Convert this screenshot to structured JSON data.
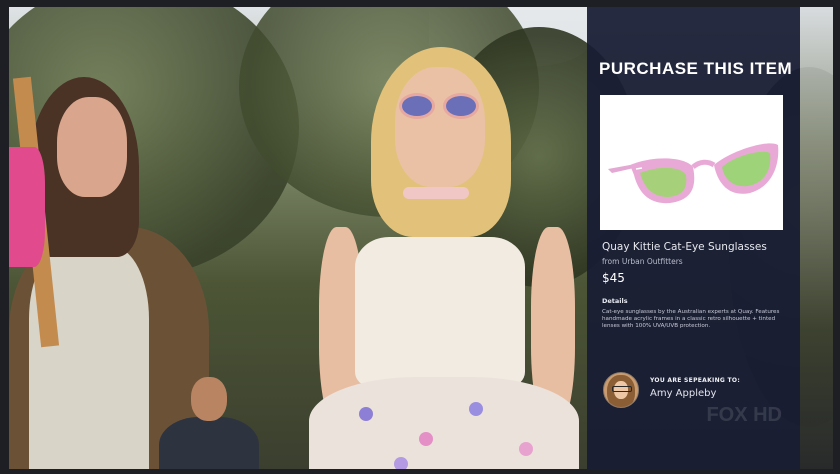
{
  "panel": {
    "title": "PURCHASE THIS ITEM",
    "product": {
      "image_icon": "sunglasses-icon",
      "name": "Quay Kittie Cat-Eye Sunglasses",
      "source": "from Urban Outfitters",
      "price": "$45",
      "details_label": "Details",
      "details_text": "Cat-eye sunglasses by the Australian experts at Quay. Features handmade acrylic frames in a classic retro silhouette + tinted lenses with 100% UVA/UVB protection."
    },
    "speaker": {
      "label": "YOU ARE SEPEAKING TO:",
      "name": "Amy Appleby"
    }
  },
  "watermark": "FOX HD",
  "colors": {
    "panel_bg": "#181c34",
    "frame_pink": "#e9a9d6",
    "lens_green": "#9fd37a"
  }
}
